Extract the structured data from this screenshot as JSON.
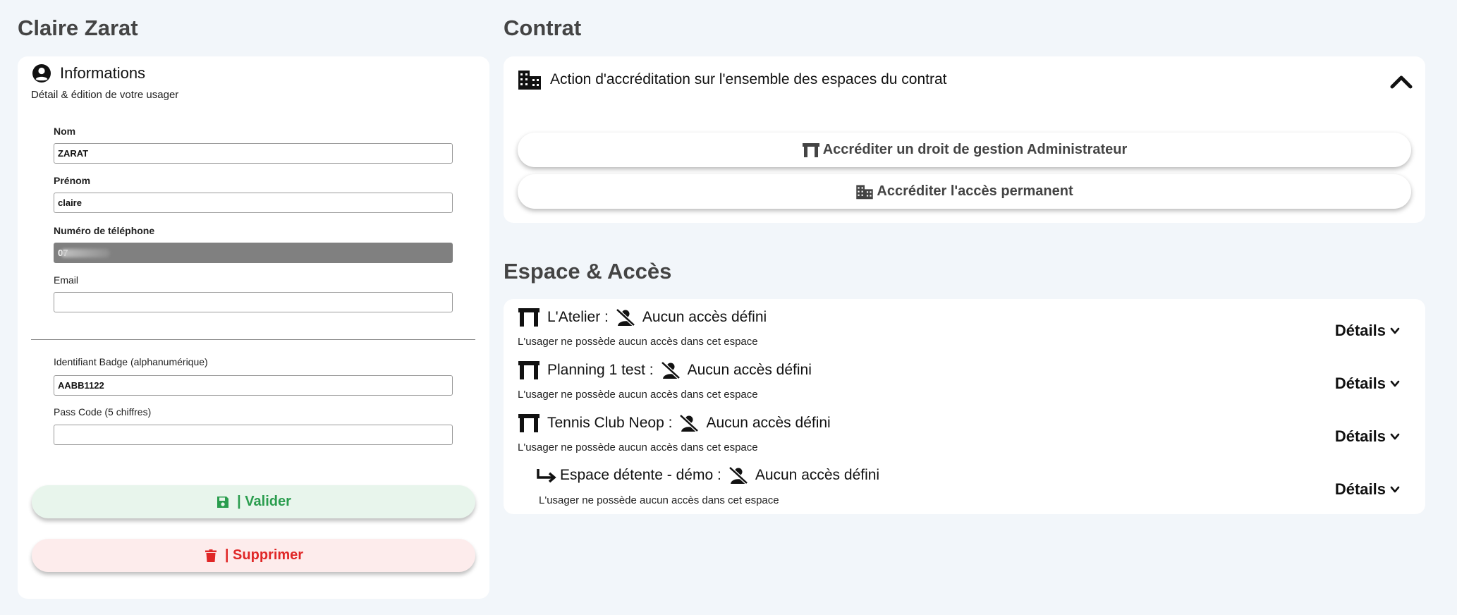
{
  "user": {
    "name": "Claire Zarat"
  },
  "info": {
    "title": "Informations",
    "subtitle": "Détail & édition de votre usager",
    "fields": {
      "nom": {
        "label": "Nom",
        "value": "ZARAT"
      },
      "prenom": {
        "label": "Prénom",
        "value": "claire"
      },
      "phone": {
        "label": "Numéro de téléphone",
        "value": "07"
      },
      "email": {
        "label": "Email",
        "value": ""
      },
      "badge": {
        "label": "Identifiant Badge (alphanumérique)",
        "value": "AABB1122"
      },
      "passcode": {
        "label": "Pass Code (5 chiffres)",
        "value": ""
      }
    },
    "validate_label": "| Valider",
    "delete_label": "| Supprimer"
  },
  "contract": {
    "heading": "Contrat",
    "accordion_title": "Action d'accréditation sur l'ensemble des espaces du contrat",
    "admin_button": "Accréditer un droit de gestion Administrateur",
    "permanent_button": "Accréditer l'accès permanent"
  },
  "spaces": {
    "heading": "Espace & Accès",
    "details_label": "Détails",
    "items": [
      {
        "name": "L'Atelier :",
        "status": "Aucun accès défini",
        "desc": "L'usager ne possède aucun accès dans cet espace"
      },
      {
        "name": "Planning 1 test :",
        "status": "Aucun accès défini",
        "desc": "L'usager ne possède aucun accès dans cet espace"
      },
      {
        "name": "Tennis Club Neop :",
        "status": "Aucun accès défini",
        "desc": "L'usager ne possède aucun accès dans cet espace"
      },
      {
        "name": "Espace détente - démo :",
        "status": "Aucun accès défini",
        "desc": "L'usager ne possède aucun accès dans cet espace"
      }
    ]
  },
  "colors": {
    "background": "#f2f6fa",
    "heading": "#444444",
    "validate_text": "#2a9d4e",
    "validate_bg": "#e8f5ec",
    "delete_text": "#e02727",
    "delete_bg": "#fdecec"
  }
}
